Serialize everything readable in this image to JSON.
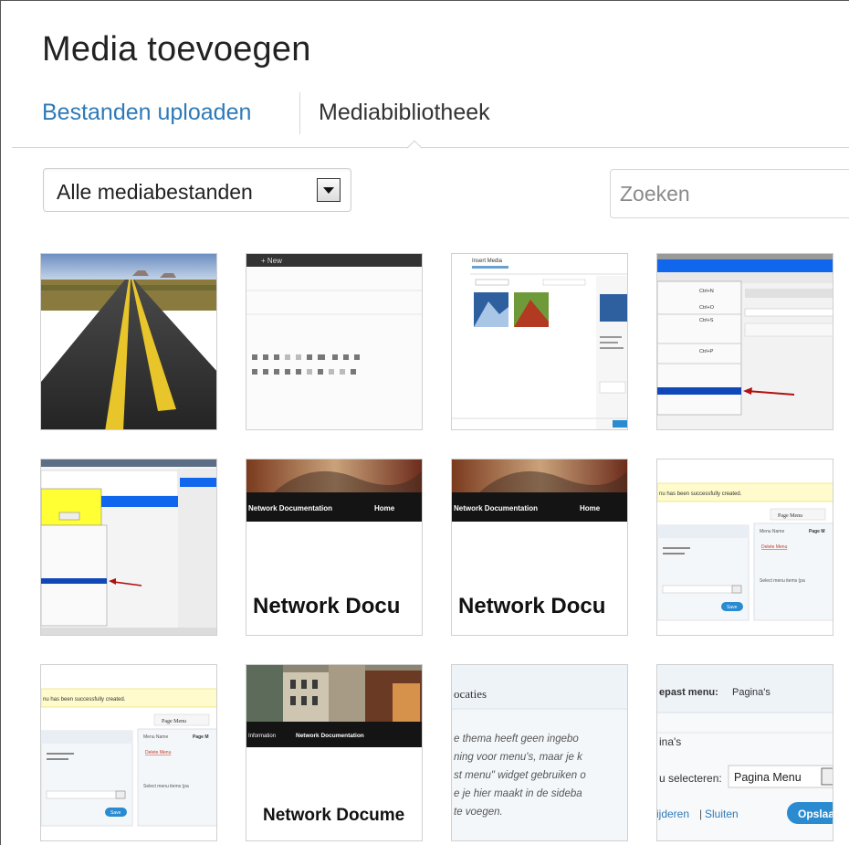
{
  "modal": {
    "title": "Media toevoegen",
    "tabs": [
      {
        "label": "Bestanden uploaden",
        "active": false
      },
      {
        "label": "Mediabibliotheek",
        "active": true
      }
    ]
  },
  "toolbar": {
    "filter_selected": "Alle mediabestanden",
    "search_placeholder": "Zoeken"
  },
  "colors": {
    "link": "#2e7ab8",
    "text": "#222222",
    "border": "#d0d0d0"
  },
  "attachments": [
    {
      "kind": "photo-road"
    },
    {
      "kind": "screenshot-editor",
      "texts": [
        "+ New"
      ]
    },
    {
      "kind": "screenshot-insert-media",
      "texts": [
        "Insert Media"
      ]
    },
    {
      "kind": "screenshot-menu",
      "texts": [
        "Ctrl+N",
        "Ctrl+O",
        "Ctrl+S",
        "Ctrl+P"
      ]
    },
    {
      "kind": "screenshot-dialog"
    },
    {
      "kind": "screenshot-website",
      "texts": [
        "Network Documentation",
        "Home",
        "Network Docu"
      ]
    },
    {
      "kind": "screenshot-website",
      "texts": [
        "Network Documentation",
        "Home",
        "Network Docu"
      ]
    },
    {
      "kind": "screenshot-menus",
      "texts": [
        "nu has been successfully created.",
        "Page Menu",
        "Menu Name",
        "Page M",
        "Delete Menu",
        "Select menu items (pa",
        "Save"
      ]
    },
    {
      "kind": "screenshot-menus",
      "texts": [
        "nu has been successfully created.",
        "Page Menu",
        "Menu Name",
        "Page M",
        "Delete Menu",
        "Select menu items (pa",
        "Save"
      ]
    },
    {
      "kind": "screenshot-website-street",
      "texts": [
        "Information",
        "Network Documentation",
        "Network Docume"
      ]
    },
    {
      "kind": "screenshot-locations",
      "texts": [
        "ocaties",
        "e thema heeft geen ingebo",
        "ning voor menu's, maar je k",
        "st menu\" widget gebruiken o",
        "e je hier maakt in de sideba",
        "te voegen."
      ]
    },
    {
      "kind": "screenshot-custom-menu",
      "texts": [
        "epast menu:",
        "Pagina's",
        "ina's",
        "u selecteren:",
        "Pagina Menu",
        "ijderen",
        "Sluiten",
        "Opslaa"
      ]
    }
  ]
}
